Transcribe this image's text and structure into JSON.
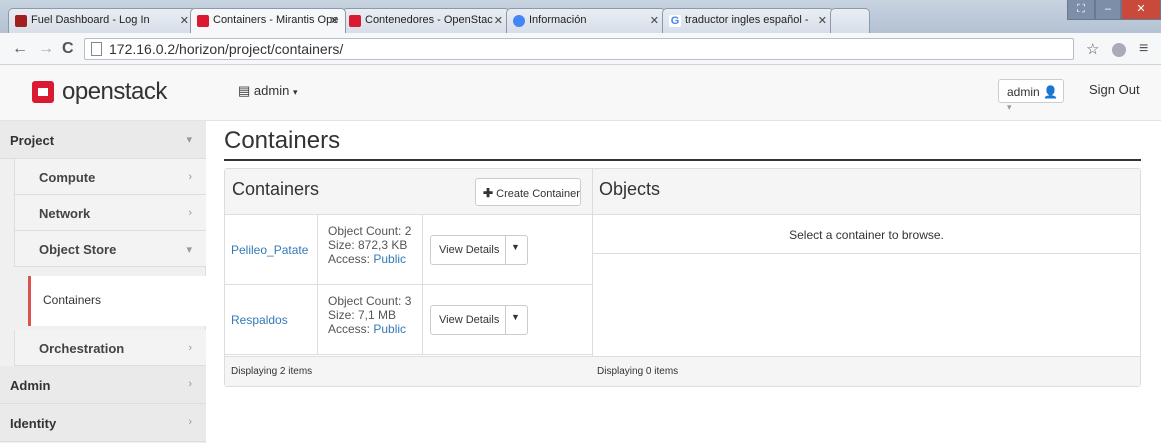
{
  "browser": {
    "tabs": [
      {
        "title": "Fuel Dashboard - Log In",
        "fav_color": "#a02020"
      },
      {
        "title": "Containers - Mirantis Ope",
        "fav_color": "#da1a32"
      },
      {
        "title": "Contenedores - OpenStac",
        "fav_color": "#da1a32"
      },
      {
        "title": "Información",
        "fav_color": "#4285f4"
      },
      {
        "title": "traductor ingles español -",
        "fav_color": "#4285f4"
      }
    ],
    "url": "172.16.0.2/horizon/project/containers/"
  },
  "header": {
    "logo_text": "openstack",
    "project_selector": "admin",
    "user_button": "admin",
    "sign_out": "Sign Out"
  },
  "sidebar": {
    "project": "Project",
    "compute": "Compute",
    "network": "Network",
    "object_store": "Object Store",
    "containers": "Containers",
    "orchestration": "Orchestration",
    "admin": "Admin",
    "identity": "Identity"
  },
  "main": {
    "page_title": "Containers",
    "containers_heading": "Containers",
    "create_button": "Create Container",
    "objects_heading": "Objects",
    "select_msg": "Select a container to browse.",
    "footer_left": "Displaying 2 items",
    "footer_right": "Displaying 0 items",
    "rows": [
      {
        "name": "Pelileo_Patate",
        "count": "Object Count: 2",
        "size": "Size: 872,3 KB",
        "access_label": "Access:",
        "access": "Public",
        "details": "View Details"
      },
      {
        "name": "Respaldos",
        "count": "Object Count: 3",
        "size": "Size: 7,1 MB",
        "access_label": "Access:",
        "access": "Public",
        "details": "View Details"
      }
    ]
  }
}
